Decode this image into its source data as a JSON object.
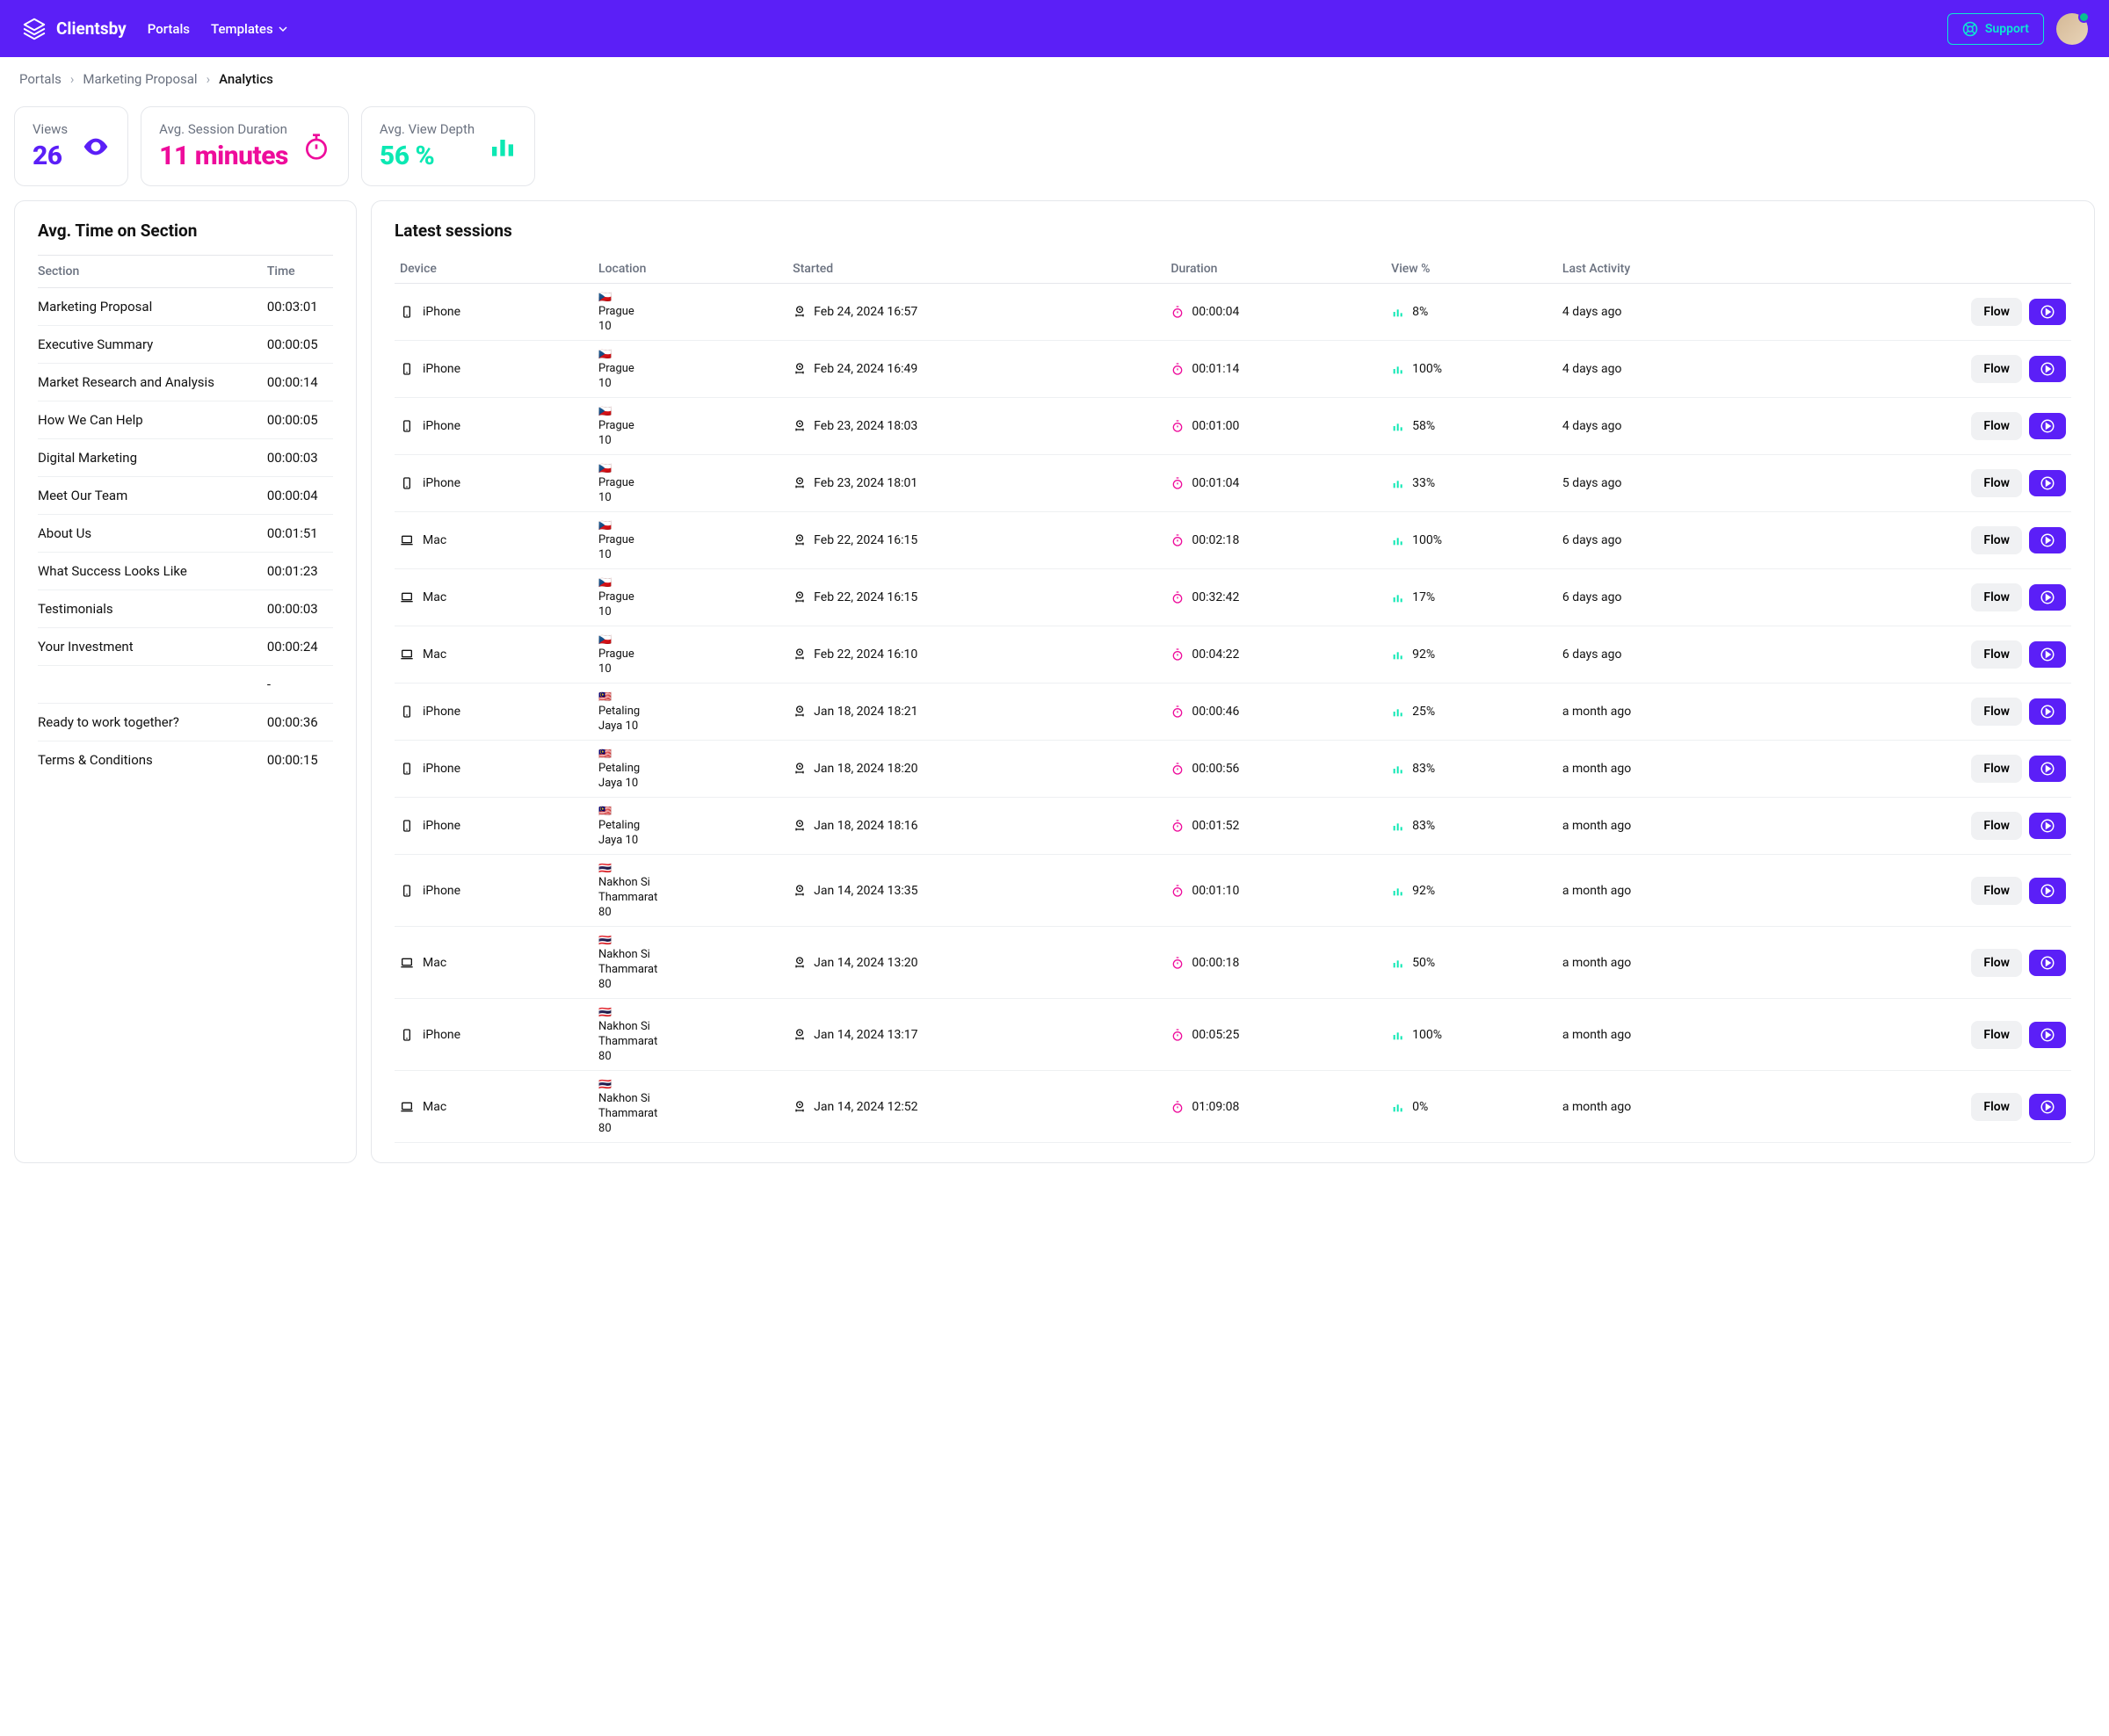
{
  "brand": "Clientsby",
  "nav": {
    "portals": "Portals",
    "templates": "Templates"
  },
  "support_label": "Support",
  "breadcrumb": {
    "portals": "Portals",
    "portal": "Marketing Proposal",
    "current": "Analytics"
  },
  "stats": {
    "views": {
      "label": "Views",
      "value": "26"
    },
    "duration": {
      "label": "Avg. Session Duration",
      "value": "11 minutes"
    },
    "depth": {
      "label": "Avg. View Depth",
      "value": "56 %"
    }
  },
  "time_on_section": {
    "title": "Avg. Time on Section",
    "cols": {
      "section": "Section",
      "time": "Time"
    },
    "rows": [
      {
        "section": "Marketing Proposal",
        "time": "00:03:01"
      },
      {
        "section": "Executive Summary",
        "time": "00:00:05"
      },
      {
        "section": "Market Research and Analysis",
        "time": "00:00:14"
      },
      {
        "section": "How We Can Help",
        "time": "00:00:05"
      },
      {
        "section": "Digital Marketing",
        "time": "00:00:03"
      },
      {
        "section": "Meet Our Team",
        "time": "00:00:04"
      },
      {
        "section": "About Us",
        "time": "00:01:51"
      },
      {
        "section": "What Success Looks Like",
        "time": "00:01:23"
      },
      {
        "section": "Testimonials",
        "time": "00:00:03"
      },
      {
        "section": "Your Investment",
        "time": "00:00:24"
      },
      {
        "section": "",
        "time": "-"
      },
      {
        "section": "Ready to work together?",
        "time": "00:00:36"
      },
      {
        "section": "Terms & Conditions",
        "time": "00:00:15"
      }
    ]
  },
  "sessions": {
    "title": "Latest sessions",
    "cols": {
      "device": "Device",
      "location": "Location",
      "started": "Started",
      "duration": "Duration",
      "view": "View %",
      "activity": "Last Activity"
    },
    "flow_label": "Flow",
    "rows": [
      {
        "device": "iPhone",
        "device_type": "phone",
        "flag": "🇨🇿",
        "loc1": "Prague",
        "loc2": "10",
        "started": "Feb 24, 2024 16:57",
        "duration": "00:00:04",
        "view": "8%",
        "activity": "4 days ago"
      },
      {
        "device": "iPhone",
        "device_type": "phone",
        "flag": "🇨🇿",
        "loc1": "Prague",
        "loc2": "10",
        "started": "Feb 24, 2024 16:49",
        "duration": "00:01:14",
        "view": "100%",
        "activity": "4 days ago"
      },
      {
        "device": "iPhone",
        "device_type": "phone",
        "flag": "🇨🇿",
        "loc1": "Prague",
        "loc2": "10",
        "started": "Feb 23, 2024 18:03",
        "duration": "00:01:00",
        "view": "58%",
        "activity": "4 days ago"
      },
      {
        "device": "iPhone",
        "device_type": "phone",
        "flag": "🇨🇿",
        "loc1": "Prague",
        "loc2": "10",
        "started": "Feb 23, 2024 18:01",
        "duration": "00:01:04",
        "view": "33%",
        "activity": "5 days ago"
      },
      {
        "device": "Mac",
        "device_type": "laptop",
        "flag": "🇨🇿",
        "loc1": "Prague",
        "loc2": "10",
        "started": "Feb 22, 2024 16:15",
        "duration": "00:02:18",
        "view": "100%",
        "activity": "6 days ago"
      },
      {
        "device": "Mac",
        "device_type": "laptop",
        "flag": "🇨🇿",
        "loc1": "Prague",
        "loc2": "10",
        "started": "Feb 22, 2024 16:15",
        "duration": "00:32:42",
        "view": "17%",
        "activity": "6 days ago"
      },
      {
        "device": "Mac",
        "device_type": "laptop",
        "flag": "🇨🇿",
        "loc1": "Prague",
        "loc2": "10",
        "started": "Feb 22, 2024 16:10",
        "duration": "00:04:22",
        "view": "92%",
        "activity": "6 days ago"
      },
      {
        "device": "iPhone",
        "device_type": "phone",
        "flag": "🇲🇾",
        "loc1": "Petaling",
        "loc2": "Jaya 10",
        "started": "Jan 18, 2024 18:21",
        "duration": "00:00:46",
        "view": "25%",
        "activity": "a month ago"
      },
      {
        "device": "iPhone",
        "device_type": "phone",
        "flag": "🇲🇾",
        "loc1": "Petaling",
        "loc2": "Jaya 10",
        "started": "Jan 18, 2024 18:20",
        "duration": "00:00:56",
        "view": "83%",
        "activity": "a month ago"
      },
      {
        "device": "iPhone",
        "device_type": "phone",
        "flag": "🇲🇾",
        "loc1": "Petaling",
        "loc2": "Jaya 10",
        "started": "Jan 18, 2024 18:16",
        "duration": "00:01:52",
        "view": "83%",
        "activity": "a month ago"
      },
      {
        "device": "iPhone",
        "device_type": "phone",
        "flag": "🇹🇭",
        "loc1": "Nakhon Si",
        "loc2": "Thammarat",
        "loc3": "80",
        "started": "Jan 14, 2024 13:35",
        "duration": "00:01:10",
        "view": "92%",
        "activity": "a month ago"
      },
      {
        "device": "Mac",
        "device_type": "laptop",
        "flag": "🇹🇭",
        "loc1": "Nakhon Si",
        "loc2": "Thammarat",
        "loc3": "80",
        "started": "Jan 14, 2024 13:20",
        "duration": "00:00:18",
        "view": "50%",
        "activity": "a month ago"
      },
      {
        "device": "iPhone",
        "device_type": "phone",
        "flag": "🇹🇭",
        "loc1": "Nakhon Si",
        "loc2": "Thammarat",
        "loc3": "80",
        "started": "Jan 14, 2024 13:17",
        "duration": "00:05:25",
        "view": "100%",
        "activity": "a month ago"
      },
      {
        "device": "Mac",
        "device_type": "laptop",
        "flag": "🇹🇭",
        "loc1": "Nakhon Si",
        "loc2": "Thammarat",
        "loc3": "80",
        "started": "Jan 14, 2024 12:52",
        "duration": "01:09:08",
        "view": "0%",
        "activity": "a month ago"
      }
    ]
  }
}
